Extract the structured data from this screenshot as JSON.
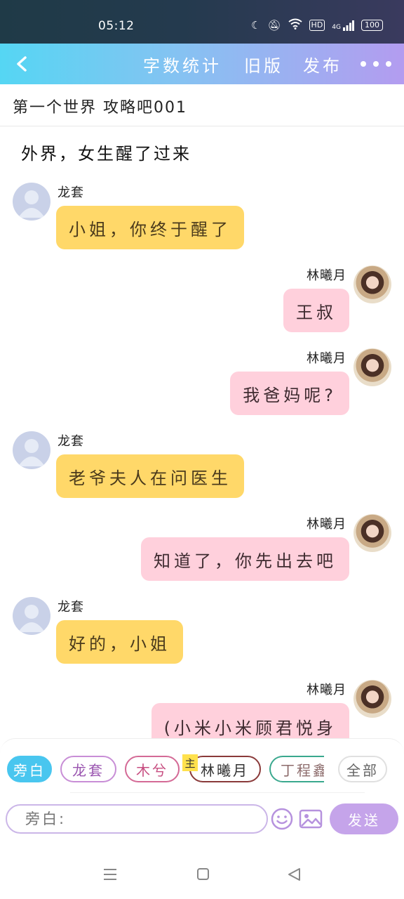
{
  "status_bar": {
    "time": "05:12",
    "icons": [
      "moon-icon",
      "mute-icon",
      "wifi-icon",
      "hd-icon",
      "signal-icon",
      "battery-icon"
    ],
    "hd": "HD",
    "network": "4G",
    "battery": "100"
  },
  "header": {
    "actions": [
      "字数统计",
      "旧版",
      "发布"
    ]
  },
  "title": "第一个世界 攻略吧001",
  "narration": "外界，女生醒了过来",
  "messages": [
    {
      "side": "left",
      "sender": "龙套",
      "text": "小姐，你终于醒了",
      "color": "yellow"
    },
    {
      "side": "right",
      "sender": "林曦月",
      "text": "王叔",
      "color": "pink"
    },
    {
      "side": "right",
      "sender": "林曦月",
      "text": "我爸妈呢?",
      "color": "pink"
    },
    {
      "side": "left",
      "sender": "龙套",
      "text": "老爷夫人在问医生",
      "color": "yellow"
    },
    {
      "side": "right",
      "sender": "林曦月",
      "text": "知道了，你先出去吧",
      "color": "pink"
    },
    {
      "side": "left",
      "sender": "龙套",
      "text": "好的，小姐",
      "color": "yellow"
    },
    {
      "side": "right",
      "sender": "林曦月",
      "text": "(小米小米顾君悦身",
      "color": "pink"
    }
  ],
  "roles": [
    "旁白",
    "龙套",
    "木兮",
    "林曦月",
    "丁程鑫",
    "全部"
  ],
  "main_tag": "主",
  "input": {
    "placeholder": "旁白:"
  },
  "send_label": "发送",
  "colors": {
    "accent_start": "#55d6f3",
    "accent_end": "#b39cf0",
    "bubble_left": "#ffd869",
    "bubble_right": "#ffd0dc",
    "send": "#c5a4ea"
  }
}
